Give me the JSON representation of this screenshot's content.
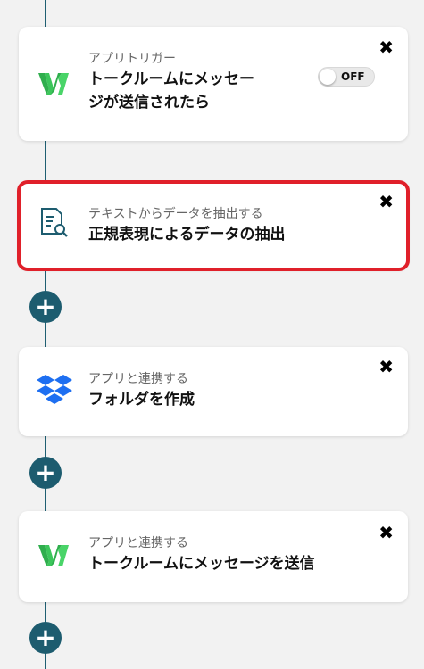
{
  "steps": [
    {
      "subtitle": "アプリトリガー",
      "title": "トークルームにメッセージが送信されたら",
      "icon": "worksmobile-logo",
      "toggle_label": "OFF"
    },
    {
      "subtitle": "テキストからデータを抽出する",
      "title": "正規表現によるデータの抽出",
      "icon": "document-search-icon",
      "selected": true
    },
    {
      "subtitle": "アプリと連携する",
      "title": "フォルダを作成",
      "icon": "dropbox-logo"
    },
    {
      "subtitle": "アプリと連携する",
      "title": "トークルームにメッセージを送信",
      "icon": "worksmobile-logo"
    }
  ],
  "close_glyph": "✖",
  "add_glyph": "+",
  "colors": {
    "accent": "#1d5c6f",
    "selected_outline": "#e0202a",
    "worksmobile_green": "#3cc65b",
    "dropbox_blue": "#1e6ff1"
  }
}
